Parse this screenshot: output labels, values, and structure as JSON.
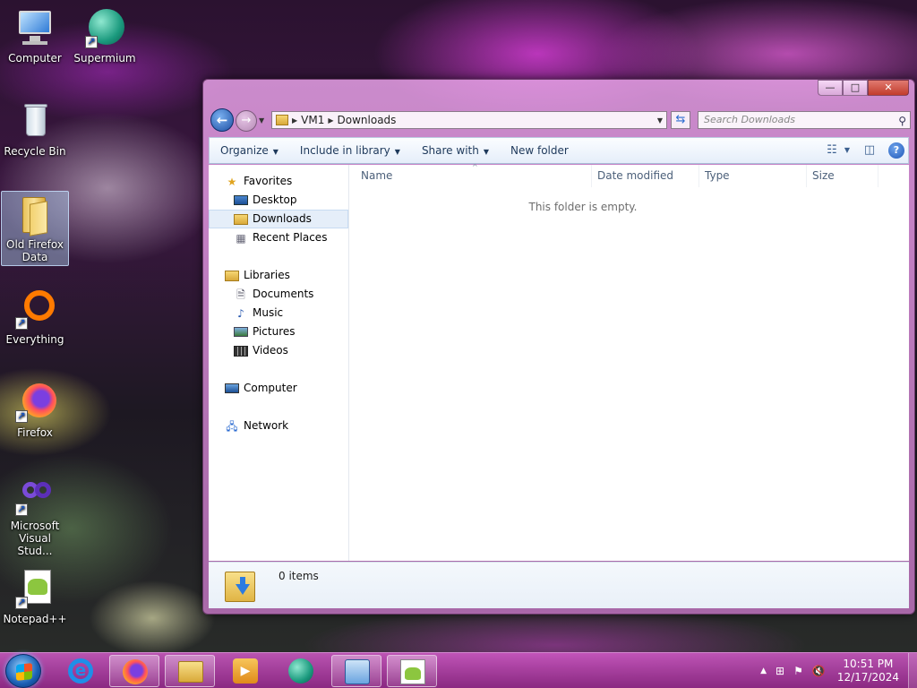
{
  "desktop": {
    "icons": [
      {
        "label": "Computer"
      },
      {
        "label": "Supermium"
      },
      {
        "label": "Recycle Bin"
      },
      {
        "label": "Old Firefox Data"
      },
      {
        "label": "Everything"
      },
      {
        "label": "Firefox"
      },
      {
        "label": "Microsoft Visual Stud..."
      },
      {
        "label": "Notepad++"
      }
    ]
  },
  "window": {
    "controls": {
      "minimize": "—",
      "maximize": "□",
      "close": "✕"
    },
    "address": {
      "segments": [
        "VM1",
        "Downloads"
      ]
    },
    "search": {
      "placeholder": "Search Downloads"
    },
    "toolbar": {
      "organize": "Organize",
      "include_in_library": "Include in library",
      "share_with": "Share with",
      "new_folder": "New folder"
    },
    "nav": {
      "favorites": "Favorites",
      "desktop": "Desktop",
      "downloads": "Downloads",
      "recent_places": "Recent Places",
      "libraries": "Libraries",
      "documents": "Documents",
      "music": "Music",
      "pictures": "Pictures",
      "videos": "Videos",
      "computer": "Computer",
      "network": "Network"
    },
    "columns": {
      "name": "Name",
      "date_modified": "Date modified",
      "type": "Type",
      "size": "Size"
    },
    "empty_message": "This folder is empty.",
    "status": {
      "item_count": "0 items"
    }
  },
  "taskbar": {
    "clock": {
      "time": "10:51 PM",
      "date": "12/17/2024"
    },
    "apps": [
      "internet-explorer",
      "firefox",
      "file-explorer",
      "media-player",
      "supermium",
      "control-panel",
      "notepad-plus-plus"
    ]
  },
  "colors": {
    "accent": "#1e395b",
    "selection": "#e5eef9",
    "taskbar": "#b040a8"
  }
}
